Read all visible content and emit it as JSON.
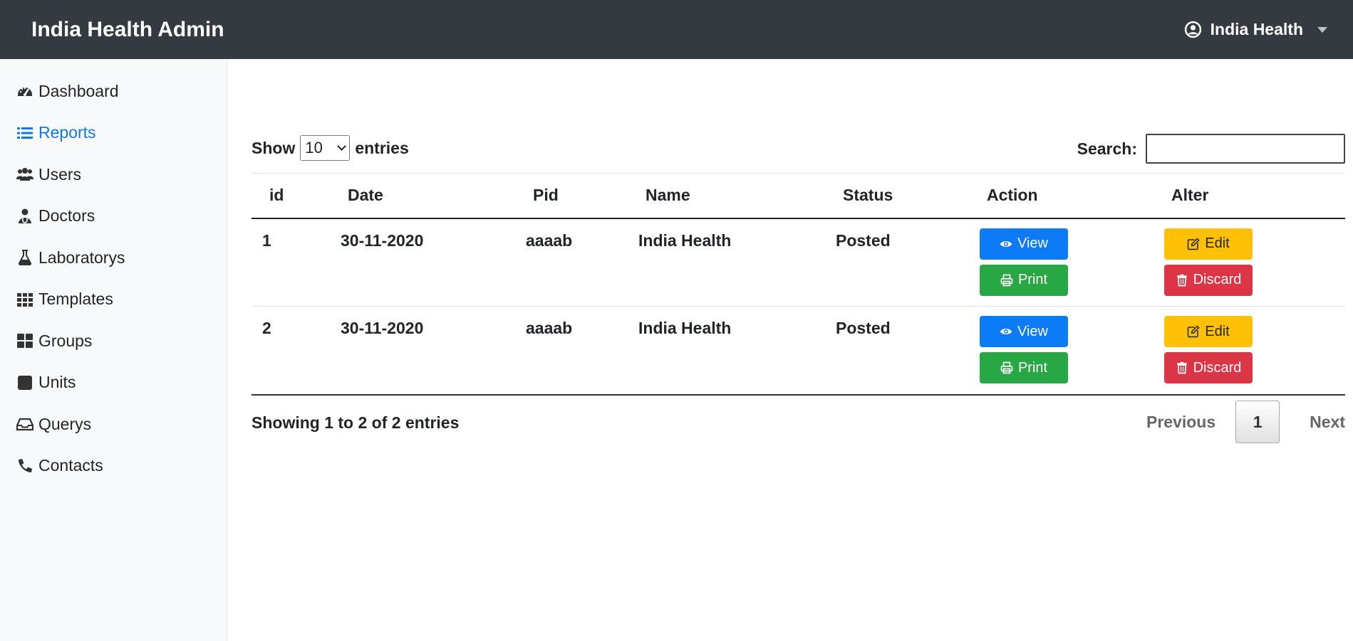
{
  "header": {
    "brand": "India Health Admin",
    "user_name": "India Health"
  },
  "sidebar": {
    "items": [
      {
        "label": "Dashboard",
        "icon": "tachometer-icon"
      },
      {
        "label": "Reports",
        "icon": "list-icon",
        "active": true
      },
      {
        "label": "Users",
        "icon": "users-icon"
      },
      {
        "label": "Doctors",
        "icon": "doctor-icon"
      },
      {
        "label": "Laboratorys",
        "icon": "flask-icon"
      },
      {
        "label": "Templates",
        "icon": "grid-icon"
      },
      {
        "label": "Groups",
        "icon": "th-large-icon"
      },
      {
        "label": "Units",
        "icon": "square-icon"
      },
      {
        "label": "Querys",
        "icon": "inbox-icon"
      },
      {
        "label": "Contacts",
        "icon": "phone-icon"
      }
    ]
  },
  "table_controls": {
    "show_label": "Show",
    "entries_label": "entries",
    "page_size": "10",
    "search_label": "Search:",
    "search_value": ""
  },
  "table": {
    "columns": [
      "id",
      "Date",
      "Pid",
      "Name",
      "Status",
      "Action",
      "Alter"
    ],
    "rows": [
      {
        "id": "1",
        "date": "30-11-2020",
        "pid": "aaaab",
        "name": "India Health",
        "status": "Posted"
      },
      {
        "id": "2",
        "date": "30-11-2020",
        "pid": "aaaab",
        "name": "India Health",
        "status": "Posted"
      }
    ],
    "buttons": {
      "view": "View",
      "print": "Print",
      "edit": "Edit",
      "discard": "Discard"
    }
  },
  "footer": {
    "info": "Showing 1 to 2 of 2 entries",
    "previous": "Previous",
    "current_page": "1",
    "next": "Next"
  },
  "colors": {
    "navbar": "#343a40",
    "active": "#1478e3",
    "view": "#0d7bf5",
    "print": "#28a745",
    "edit": "#ffc107",
    "discard": "#dc3545"
  }
}
